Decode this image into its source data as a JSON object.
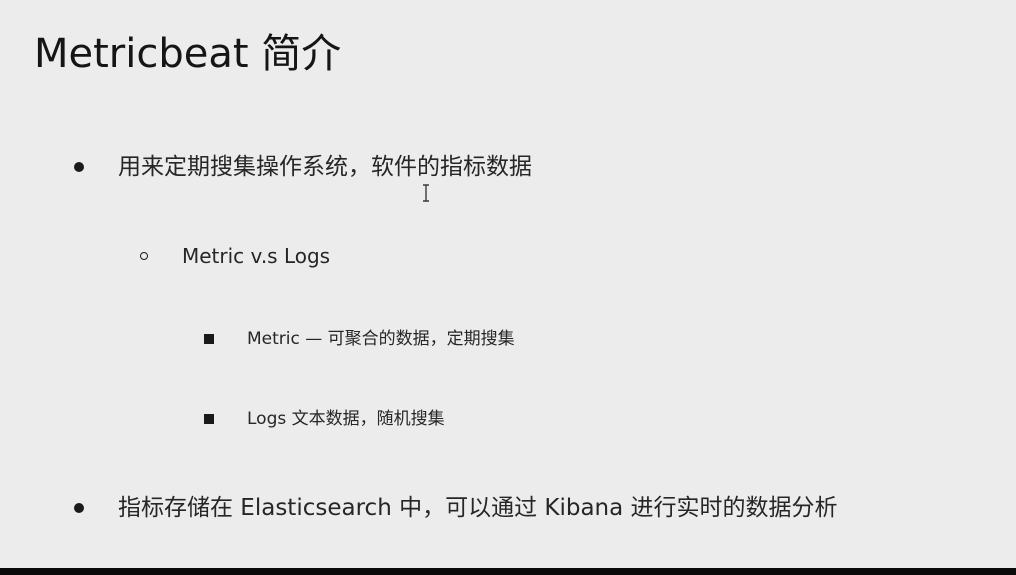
{
  "slide": {
    "title": "Metricbeat 简介",
    "bullets": [
      {
        "text": "用来定期搜集操作系统，软件的指标数据",
        "level": 1
      },
      {
        "text": "Metric v.s Logs",
        "level": 2
      },
      {
        "text": "Metric — 可聚合的数据，定期搜集",
        "level": 3
      },
      {
        "text": "Logs 文本数据，随机搜集",
        "level": 3
      },
      {
        "text": "指标存储在 Elasticsearch 中，可以通过 Kibana 进行实时的数据分析",
        "level": 1
      }
    ]
  },
  "cursor": {
    "icon": "text-cursor-icon"
  }
}
